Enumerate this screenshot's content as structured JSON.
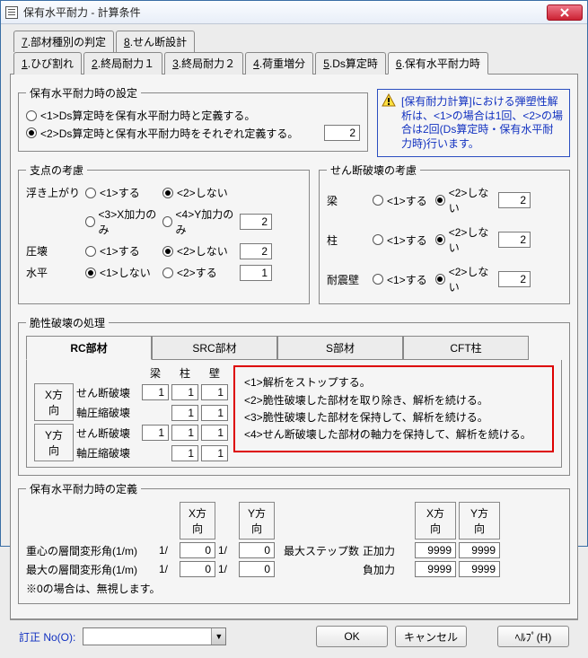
{
  "window": {
    "title": "保有水平耐力 - 計算条件"
  },
  "tabsTop": [
    {
      "n": "7",
      "label": "部材種別の判定"
    },
    {
      "n": "8",
      "label": "せん断設計"
    }
  ],
  "tabsMain": [
    {
      "n": "1",
      "label": "ひび割れ"
    },
    {
      "n": "2",
      "label": "終局耐力１"
    },
    {
      "n": "3",
      "label": "終局耐力２"
    },
    {
      "n": "4",
      "label": "荷重増分"
    },
    {
      "n": "5",
      "label": "Ds算定時"
    },
    {
      "n": "6",
      "label": "保有水平耐力時"
    }
  ],
  "setting": {
    "legend": "保有水平耐力時の設定",
    "opt1": "<1>Ds算定時を保有水平耐力時と定義する。",
    "opt2": "<2>Ds算定時と保有水平耐力時をそれぞれ定義する。",
    "value": "2"
  },
  "notice": "[保有耐力計算]における弾塑性解析は、<1>の場合は1回、<2>の場合は2回(Ds算定時・保有水平耐力時)行います。",
  "fulcrum": {
    "legend": "支点の考慮",
    "rows": [
      {
        "label": "浮き上がり",
        "opts": [
          "<1>する",
          "<2>しない",
          "<3>X加力のみ",
          "<4>Y加力のみ"
        ],
        "sel": 1,
        "value": "2"
      },
      {
        "label": "圧壊",
        "opts": [
          "<1>する",
          "<2>しない"
        ],
        "sel": 1,
        "value": "2"
      },
      {
        "label": "水平",
        "opts": [
          "<1>しない",
          "<2>する"
        ],
        "sel": 0,
        "value": "1"
      }
    ]
  },
  "shear": {
    "legend": "せん断破壊の考慮",
    "rows": [
      {
        "label": "梁",
        "opts": [
          "<1>する",
          "<2>しない"
        ],
        "sel": 1,
        "value": "2"
      },
      {
        "label": "柱",
        "opts": [
          "<1>する",
          "<2>しない"
        ],
        "sel": 1,
        "value": "2"
      },
      {
        "label": "耐震壁",
        "opts": [
          "<1>する",
          "<2>しない"
        ],
        "sel": 1,
        "value": "2"
      }
    ]
  },
  "brittle": {
    "legend": "脆性破壊の処理",
    "innerTabs": [
      "RC部材",
      "SRC部材",
      "S部材",
      "CFT柱"
    ],
    "colHeaders": [
      "梁",
      "柱",
      "壁"
    ],
    "rows": [
      {
        "dirBtn": "X方向",
        "items": [
          {
            "label": "せん断破壊",
            "v": [
              "1",
              "1",
              "1"
            ]
          },
          {
            "label": "軸圧縮破壊",
            "v": [
              "",
              "1",
              "1"
            ]
          }
        ]
      },
      {
        "dirBtn": "Y方向",
        "items": [
          {
            "label": "せん断破壊",
            "v": [
              "1",
              "1",
              "1"
            ]
          },
          {
            "label": "軸圧縮破壊",
            "v": [
              "",
              "1",
              "1"
            ]
          }
        ]
      }
    ],
    "redbox": [
      "<1>解析をストップする。",
      "<2>脆性破壊した部材を取り除き、解析を続ける。",
      "<3>脆性破壊した部材を保持して、解析を続ける。",
      "<4>せん断破壊した部材の軸力を保持して、解析を続ける。"
    ]
  },
  "definition": {
    "legend": "保有水平耐力時の定義",
    "cols": [
      "X方向",
      "Y方向"
    ],
    "rows": [
      {
        "label": "重心の層間変形角(1/m)",
        "prefix": "1/",
        "v": [
          "0",
          "0"
        ]
      },
      {
        "label": "最大の層間変形角(1/m)",
        "prefix": "1/",
        "v": [
          "0",
          "0"
        ]
      }
    ],
    "note": "※0の場合は、無視します。",
    "right": {
      "header": "最大ステップ数",
      "rows": [
        {
          "label": "正加力",
          "v": [
            "9999",
            "9999"
          ]
        },
        {
          "label": "負加力",
          "v": [
            "9999",
            "9999"
          ]
        }
      ]
    }
  },
  "bottom": {
    "revLabel": "訂正 No(O):",
    "ok": "OK",
    "cancel": "キャンセル",
    "help": "ﾍﾙﾌﾟ(H)"
  }
}
